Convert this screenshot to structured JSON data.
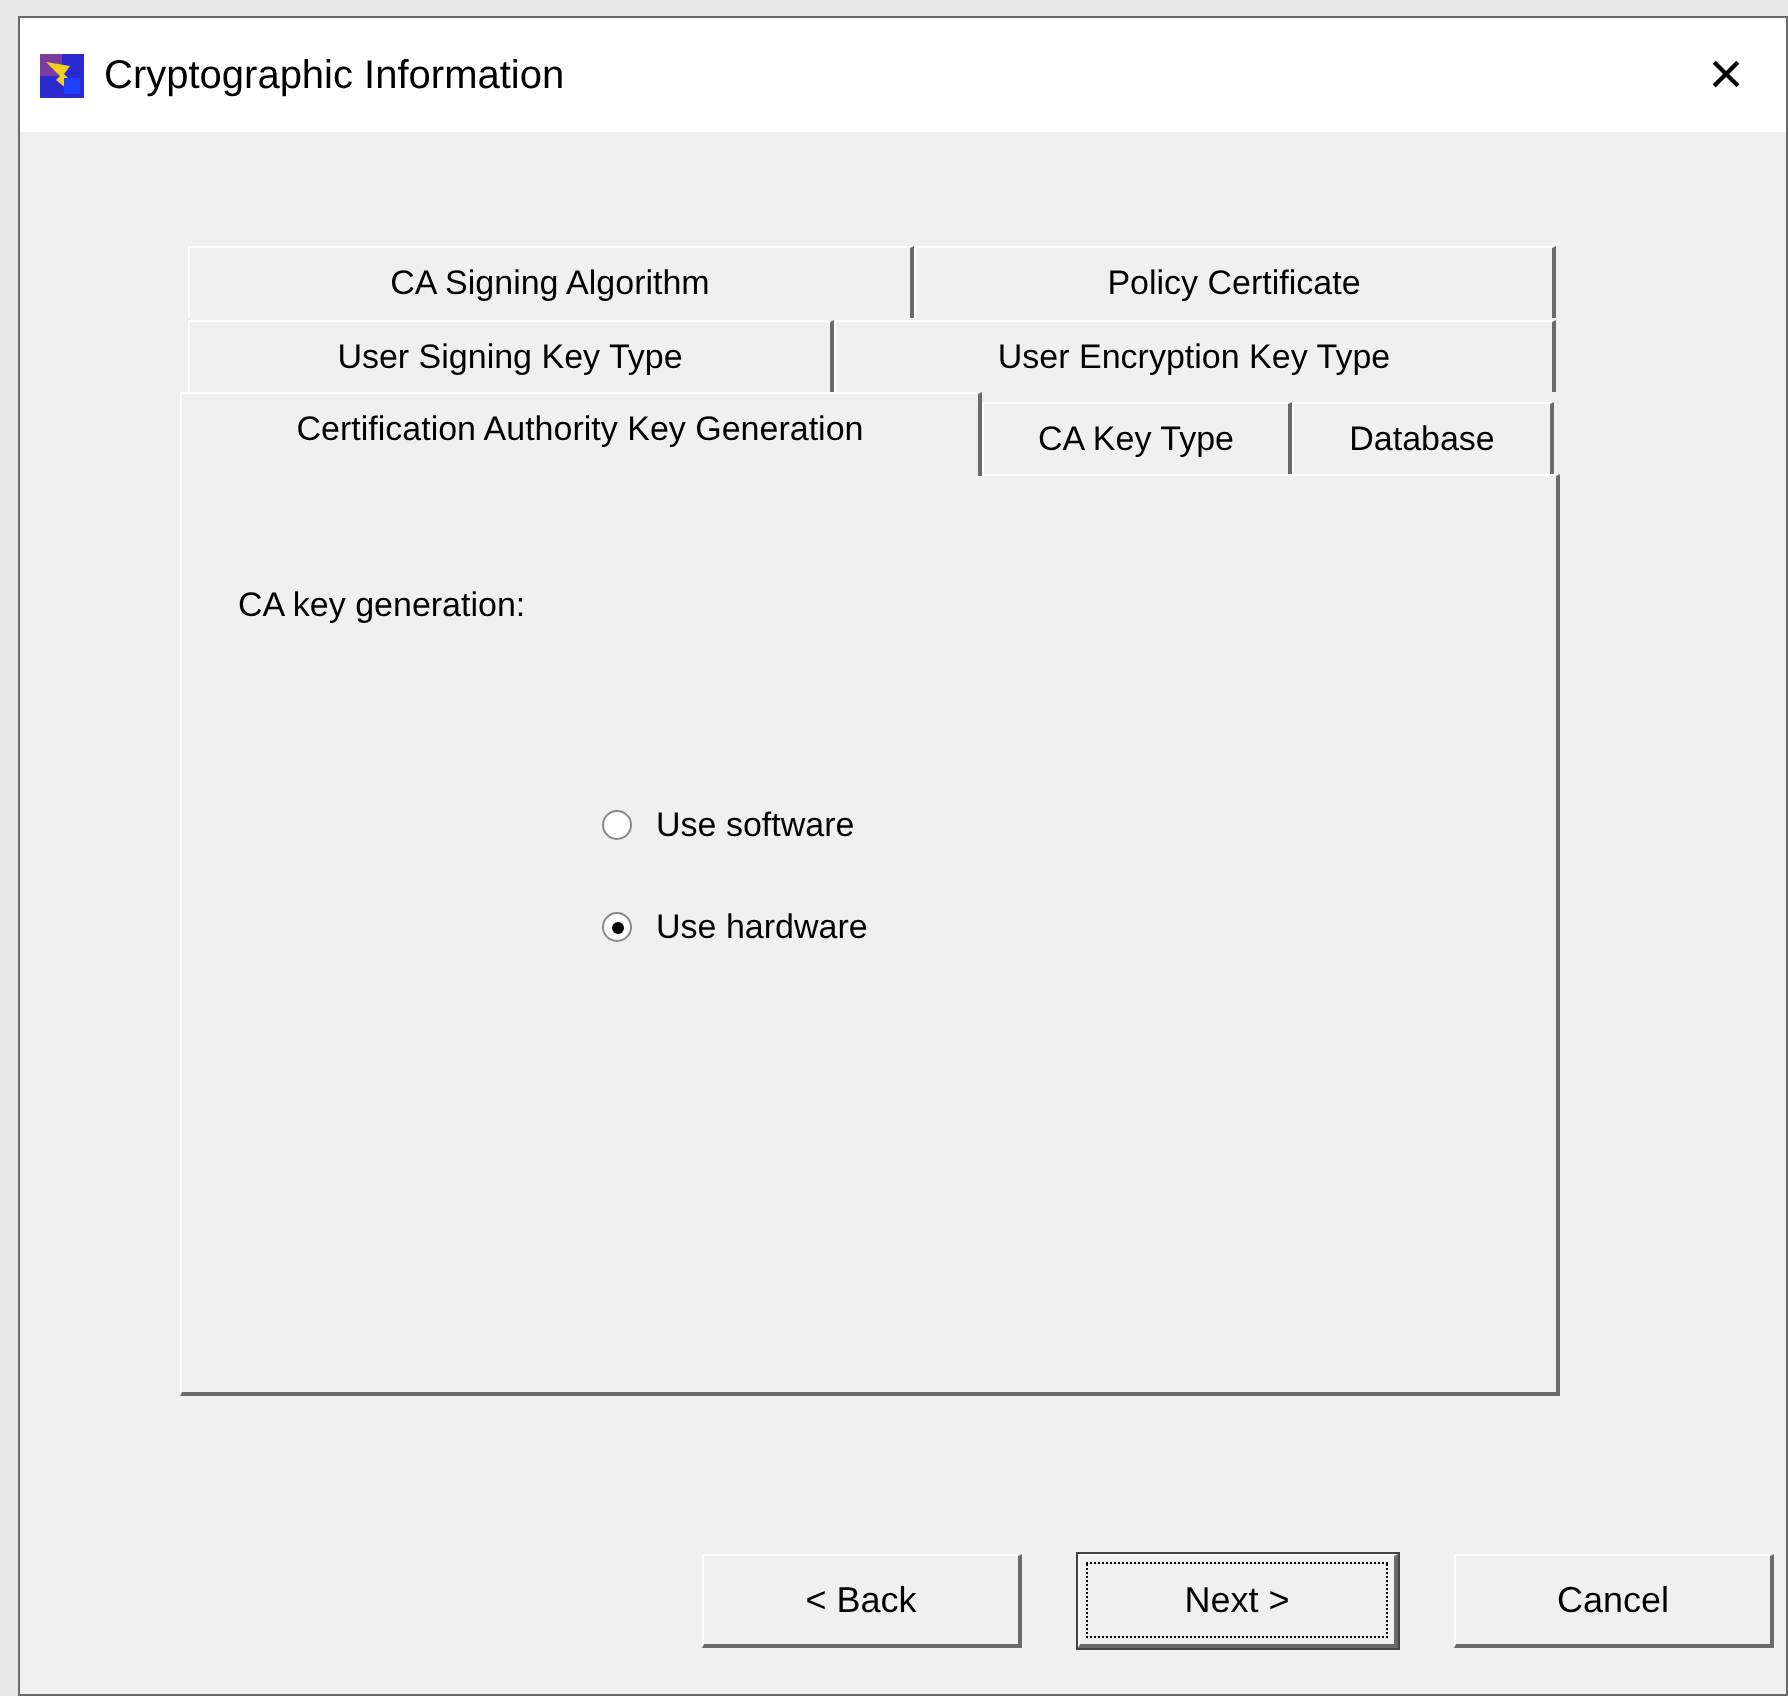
{
  "window": {
    "title": "Cryptographic Information",
    "close": "×"
  },
  "tab_rows": [
    [
      {
        "label": "CA Signing Algorithm",
        "selected": false
      },
      {
        "label": "Policy Certificate",
        "selected": false
      }
    ],
    [
      {
        "label": "User Signing Key Type",
        "selected": false
      },
      {
        "label": "User Encryption Key Type",
        "selected": false
      }
    ],
    [
      {
        "label": "Certification Authority Key Generation",
        "selected": true
      },
      {
        "label": "CA Key Type",
        "selected": false
      },
      {
        "label": "Database",
        "selected": false
      }
    ]
  ],
  "panel": {
    "label": "CA key generation:",
    "options": [
      {
        "label": "Use software",
        "selected": false
      },
      {
        "label": "Use hardware",
        "selected": true
      }
    ]
  },
  "buttons": [
    {
      "label": "< Back",
      "focused": false
    },
    {
      "label": "Next >",
      "focused": true
    },
    {
      "label": "Cancel",
      "focused": false
    }
  ]
}
